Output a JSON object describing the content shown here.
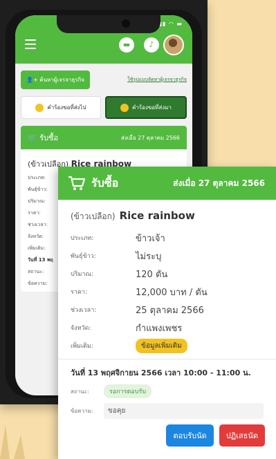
{
  "phone_screen": {
    "find_button": "ค้นหาผู้เจรจาธุรกิจ",
    "link": "ใช้รูปแบบจัดหาผู้เจรจาธุรกิจ",
    "tabs": [
      {
        "label": "คำร้องขอที่ส่งไป"
      },
      {
        "label": "คำร้องขอที่ส่งมา"
      }
    ],
    "mini_card": {
      "title": "รับซื้อ",
      "date": "ส่งเมื่อ 27 ตุลาคม 2566",
      "product_type": "(ข้าวเปลือก)",
      "product_name": "Rice rainbow",
      "rows": [
        "ประเภท:",
        "พันธุ์ข้าว:",
        "ปริมาณ:",
        "ราคา:",
        "ช่วงเวลา:",
        "จังหวัด:",
        "เพิ่มเติม:"
      ],
      "slot": "วันที่ 13 พฤ",
      "status_label": "สถานะ:",
      "msg_label": "ข้อความ:"
    }
  },
  "card": {
    "title": "รับซื้อ",
    "date": "ส่งเมื่อ 27 ตุลาคม 2566",
    "product_type": "(ข้าวเปลือก)",
    "product_name": "Rice rainbow",
    "details": {
      "type_label": "ประเภท:",
      "type_value": "ข้าวเจ้า",
      "variety_label": "พันธุ์ข้าว:",
      "variety_value": "ไม่ระบุ",
      "quantity_label": "ปริมาณ:",
      "quantity_value": "120 ตัน",
      "price_label": "ราคา:",
      "price_value": "12,000 บาท / ตัน",
      "period_label": "ช่วงเวลา:",
      "period_value": "25 ตุลาคม 2566",
      "province_label": "จังหวัด:",
      "province_value": "กำแพงเพชร",
      "extra_label": "เพิ่มเติม:",
      "extra_value": "ข้อมูลเพิ่มเติม"
    },
    "slot": "วันที่ 13 พฤศจิกายน 2566 เวลา 10:00 - 11:00 น.",
    "status_label": "สถานะ:",
    "status_value": "รอการตอบรับ",
    "message_label": "ข้อความ:",
    "message_value": "ขอคุย",
    "accept_label": "ตอบรับนัด",
    "reject_label": "ปฏิเสธนัด"
  },
  "colors": {
    "primary_green": "#52ba3f",
    "accept_blue": "#1c86e0",
    "reject_red": "#e23b3b",
    "badge_yellow": "#f2c221"
  }
}
